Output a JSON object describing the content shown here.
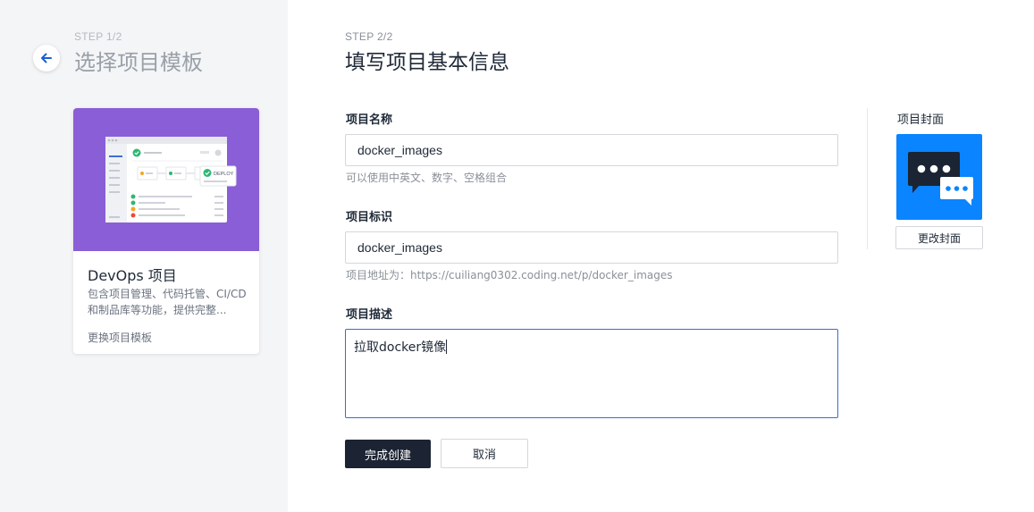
{
  "step1": {
    "label": "STEP 1/2",
    "title": "选择项目模板"
  },
  "template_card": {
    "name": "DevOps 项目",
    "description": "包含项目管理、代码托管、CI/CD 和制品库等功能，提供完整...",
    "change_link": "更换项目模板",
    "illustration_badge": "DEPLOY",
    "banner_color": "#8a5ed6"
  },
  "step2": {
    "label": "STEP 2/2",
    "title": "填写项目基本信息"
  },
  "form": {
    "name_label": "项目名称",
    "name_value": "docker_images",
    "name_hint": "可以使用中英文、数字、空格组合",
    "identifier_label": "项目标识",
    "identifier_value": "docker_images",
    "identifier_hint": "项目地址为：https://cuiliang0302.coding.net/p/docker_images",
    "description_label": "项目描述",
    "description_value": "拉取docker镜像"
  },
  "actions": {
    "submit_label": "完成创建",
    "cancel_label": "取消"
  },
  "cover": {
    "label": "项目封面",
    "change_label": "更改封面",
    "color": "#0a84ff",
    "icon": "chat-bubbles-icon"
  },
  "colors": {
    "primary_button": "#1c2433",
    "focus_border": "#3b6bd1",
    "left_panel_bg": "#f4f5f7"
  }
}
